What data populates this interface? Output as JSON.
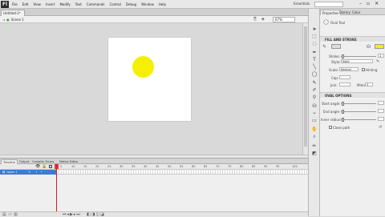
{
  "app": {
    "logo": "Fl"
  },
  "menu": [
    "File",
    "Edit",
    "View",
    "Insert",
    "Modify",
    "Text",
    "Commands",
    "Control",
    "Debug",
    "Window",
    "Help"
  ],
  "workspace": "Essentials",
  "window_controls": [
    "–",
    "▫",
    "✕"
  ],
  "document": {
    "tab": "Untitled-1*"
  },
  "editbar": {
    "scene": "Scene 1",
    "zoom": "67%"
  },
  "properties": {
    "tabs": [
      "Properties",
      "Library",
      "Color"
    ],
    "tool_name": "Oval Tool",
    "sections": {
      "fill_stroke": "FILL AND STROKE",
      "oval_options": "OVAL OPTIONS"
    },
    "labels": {
      "stroke": "Stroke:",
      "style": "Style:",
      "scale": "Scale:",
      "hinting": "Hinting",
      "cap": "Cap:",
      "join": "Join:",
      "miter": "Miter:",
      "start_angle": "Start angle:",
      "end_angle": "End angle:",
      "inner_radius": "Inner radius:",
      "close_path": "Close path"
    },
    "values": {
      "style": "Solid",
      "scale": "Normal",
      "stroke": "1",
      "miter": "3"
    },
    "colors": {
      "stroke_color": "#dcdcdc",
      "fill_color": "#f5f000"
    }
  },
  "timeline": {
    "tabs": [
      "Timeline",
      "Output",
      "Compiler Errors",
      "Motion Editor"
    ],
    "layer_name": "Layer 1",
    "frame_numbers": [
      "5",
      "10",
      "15",
      "20",
      "25",
      "30",
      "35",
      "40",
      "45",
      "50",
      "55",
      "60",
      "65",
      "70",
      "75",
      "80",
      "85",
      "90",
      "95",
      "100"
    ]
  },
  "canvas": {
    "stage_color": "#ffffff",
    "circle_color": "#f5f000"
  }
}
